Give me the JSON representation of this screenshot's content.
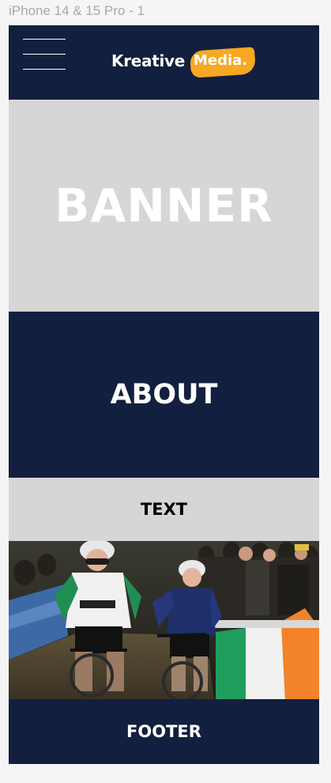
{
  "canvas": {
    "frame_label": "iPhone 14 & 15 Pro - 1"
  },
  "header": {
    "menu_icon": "hamburger-menu-icon",
    "logo": {
      "part1": "Kreative",
      "part2": "Media."
    }
  },
  "banner": {
    "title": "BANNER"
  },
  "about": {
    "title": "ABOUT"
  },
  "text_section": {
    "title": "TEXT"
  },
  "photo": {
    "flag_colors": [
      "#1f9e5d",
      "#f1f1ef",
      "#f2832a"
    ]
  },
  "footer": {
    "title": "FOOTER"
  },
  "colors": {
    "navy": "#131f3f",
    "gray": "#d6d6d6",
    "accent": "#f7a823"
  }
}
